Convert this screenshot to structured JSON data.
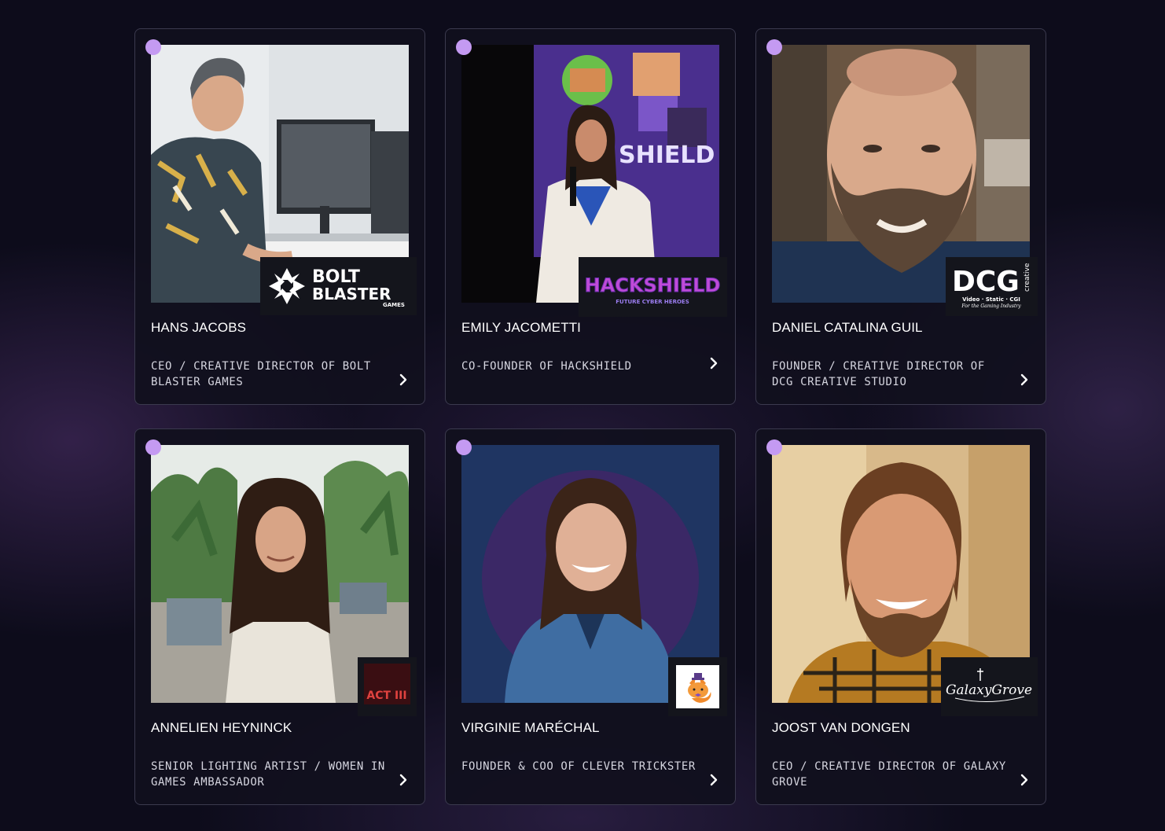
{
  "speakers": [
    {
      "name": "HANS JACOBS",
      "role": "CEO / CREATIVE DIRECTOR OF BOLT BLASTER GAMES",
      "logo": {
        "line1": "BOLT",
        "line2": "BLASTER",
        "sub": "GAMES"
      }
    },
    {
      "name": "EMILY JACOMETTI",
      "role": "CO-FOUNDER OF HACKSHIELD",
      "logo": {
        "line1": "HACKSHIELD",
        "sub": "FUTURE CYBER HEROES"
      }
    },
    {
      "name": "DANIEL CATALINA GUIL",
      "role": "FOUNDER / CREATIVE DIRECTOR OF DCG CREATIVE STUDIO",
      "logo": {
        "line1": "DCG",
        "side": "creative",
        "sub": "Video · Static · CGI",
        "sub2": "For the Gaming Industry"
      }
    },
    {
      "name": "ANNELIEN HEYNINCK",
      "role": "SENIOR LIGHTING ARTIST / WOMEN IN GAMES AMBASSADOR",
      "logo": {
        "line1": "ACT III"
      }
    },
    {
      "name": "VIRGINIE MARÉCHAL",
      "role": "FOUNDER & COO OF CLEVER TRICKSTER",
      "logo": {}
    },
    {
      "name": "JOOST VAN DONGEN",
      "role": "CEO / CREATIVE DIRECTOR OF GALAXY GROVE",
      "logo": {
        "line1": "GalaxyGrove"
      }
    }
  ],
  "icons": {
    "status": "status-dot-icon",
    "chevron": "chevron-right-icon"
  },
  "colors": {
    "accent": "#c49af2",
    "background": "#0d0c1b",
    "card_border": "#3b3a4e"
  }
}
